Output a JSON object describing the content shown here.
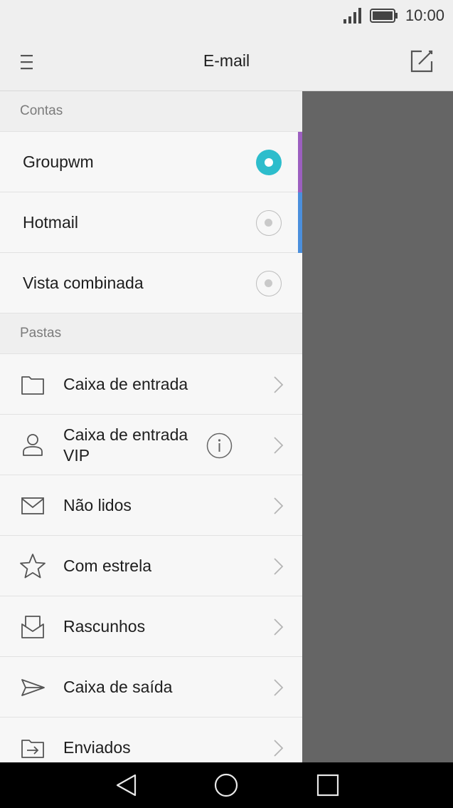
{
  "status_bar": {
    "time": "10:00",
    "signal_icon": "signal-icon",
    "battery_icon": "battery-icon"
  },
  "app_bar": {
    "title": "E-mail",
    "menu_icon": "hamburger-menu-icon",
    "compose_icon": "compose-icon"
  },
  "drawer": {
    "accounts_header": "Contas",
    "accounts": [
      {
        "label": "Groupwm",
        "selected": true,
        "accent_color": "#9c5fc0"
      },
      {
        "label": "Hotmail",
        "selected": false,
        "accent_color": "#4b8fdc"
      },
      {
        "label": "Vista combinada",
        "selected": false
      }
    ],
    "folders_header": "Pastas",
    "folders": [
      {
        "label": "Caixa de entrada",
        "icon": "folder-icon"
      },
      {
        "label": "Caixa de entrada VIP",
        "icon": "person-icon",
        "info_icon": "info-icon"
      },
      {
        "label": "Não lidos",
        "icon": "envelope-icon"
      },
      {
        "label": "Com estrela",
        "icon": "star-icon"
      },
      {
        "label": "Rascunhos",
        "icon": "drafts-icon"
      },
      {
        "label": "Caixa de saída",
        "icon": "send-icon"
      },
      {
        "label": "Enviados",
        "icon": "sent-folder-icon"
      }
    ]
  },
  "colors": {
    "accent": "#2dbdcc",
    "overlay": "#656565",
    "nav_bar": "#000000"
  },
  "nav_bar": {
    "back_icon": "back-icon",
    "home_icon": "home-icon",
    "recents_icon": "recents-icon"
  }
}
